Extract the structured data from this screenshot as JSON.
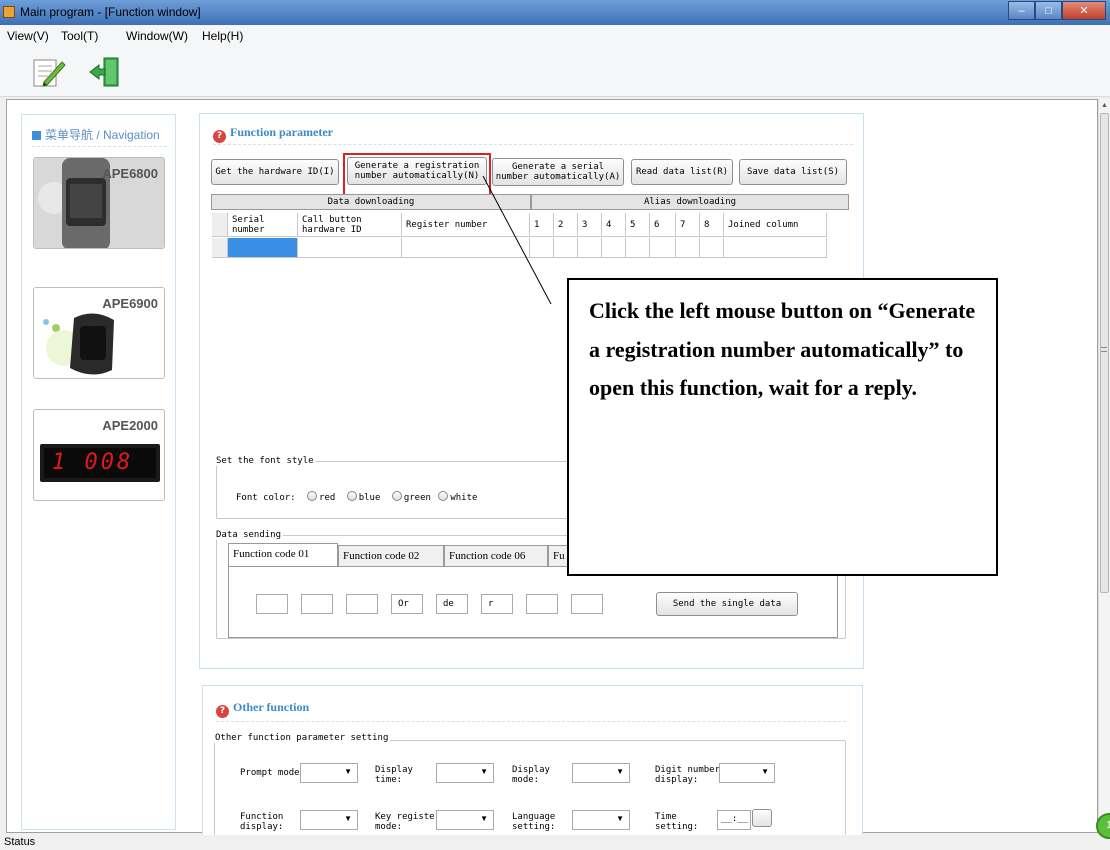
{
  "window": {
    "title": "Main program - [Function window]"
  },
  "menu": [
    "View(V)",
    "Tool(T)",
    "Window(W)",
    "Help(H)"
  ],
  "toolbar": {
    "edit_icon": "edit-note-icon",
    "exit_icon": "exit-door-icon"
  },
  "nav": {
    "header": "菜单导航 / Navigation",
    "products": [
      "APE6800",
      "APE6900",
      "APE2000"
    ],
    "ape2000_display": "1 008"
  },
  "function_param": {
    "title": "Function parameter",
    "buttons": {
      "get_hw_id": "Get the hardware ID(I)",
      "gen_reg_line1": "Generate a registration",
      "gen_reg_line2": "number automatically(N)",
      "gen_serial_line1": "Generate a serial",
      "gen_serial_line2": "number automatically(A)",
      "read_list": "Read data list(R)",
      "save_list": "Save data list(S)"
    },
    "grid": {
      "group_data": "Data downloading",
      "group_alias": "Alias downloading",
      "col_serial_1": "Serial",
      "col_serial_2": "number",
      "col_hwid_1": "Call button",
      "col_hwid_2": "hardware ID",
      "col_register": "Register number",
      "alias_cols": [
        "1",
        "2",
        "3",
        "4",
        "5",
        "6",
        "7",
        "8"
      ],
      "col_joined": "Joined column"
    },
    "font_style": {
      "label": "Set the font style",
      "font_color_label": "Font color:",
      "options": [
        "red",
        "blue",
        "green",
        "white"
      ]
    },
    "data_sending": {
      "label": "Data sending",
      "tabs": [
        "Function code 01",
        "Function code 02",
        "Function code 06",
        "Fu"
      ],
      "boxes": [
        "",
        "",
        "",
        "Or",
        "de",
        "r",
        "",
        ""
      ],
      "send_button": "Send the single data"
    }
  },
  "callout": {
    "text": "Click the left mouse button on “Generate a registration number automatically” to open this function, wait for a reply."
  },
  "other_function": {
    "title": "Other function",
    "group_label": "Other function parameter setting",
    "row1": [
      {
        "l1": "Prompt mode:",
        "l2": ""
      },
      {
        "l1": "Display",
        "l2": "time:"
      },
      {
        "l1": "Display",
        "l2": "mode:"
      },
      {
        "l1": "Digit number",
        "l2": "display:"
      }
    ],
    "row2": [
      {
        "l1": "Function",
        "l2": "display:"
      },
      {
        "l1": "Key register",
        "l2": "mode:"
      },
      {
        "l1": "Language",
        "l2": "setting:"
      },
      {
        "l1": "Time",
        "l2": "setting:"
      }
    ],
    "time_value": "__:__"
  },
  "status": {
    "text": "Status",
    "badge": "1"
  },
  "colors": {
    "titlebar": "#3d6fb6",
    "highlight": "#e02020",
    "accent": "#3d8bc7"
  }
}
